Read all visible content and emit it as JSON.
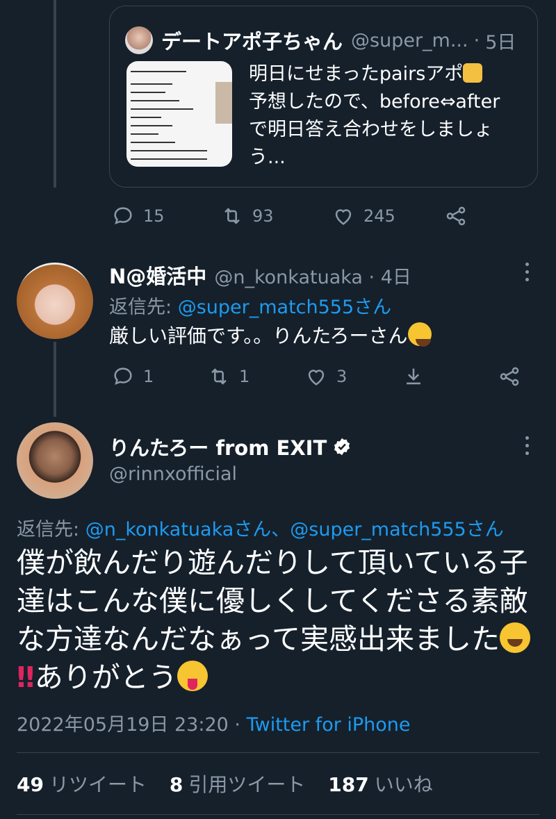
{
  "quoted_tweet": {
    "name": "デートアポ子ちゃん",
    "handle": "@super_m...",
    "sep": "·",
    "time": "5日",
    "text_lines": [
      "明日にせまったpairsアポ",
      "予想したので、before⇔after",
      "で明日答え合わせをしましょ",
      "う..."
    ]
  },
  "quoted_actions": {
    "replies": "15",
    "retweets": "93",
    "likes": "245"
  },
  "reply_tweet": {
    "name": "N@婚活中",
    "handle": "@n_konkatuaka · 4日",
    "replying_prefix": "返信先:",
    "replying_to": "@super_match555さん",
    "text": "厳しい評価です。。りんたろーさん"
  },
  "reply_actions": {
    "replies": "1",
    "retweets": "1",
    "likes": "3"
  },
  "main_tweet": {
    "name": "りんたろー from EXIT",
    "handle": "@rinnxofficial",
    "replying_prefix": "返信先:",
    "replying_to": "@n_konkatuakaさん、@super_match555さん",
    "text": "僕が飲んだり遊んだりして頂いている子達はこんな僕に優しくしてくださる素敵な方達なんだなぁって実感出来ました",
    "text_tail": "ありがとう",
    "timestamp": "2022年05月19日 23:20",
    "source_sep": "·",
    "source": "Twitter for iPhone"
  },
  "stats": {
    "retweets_count": "49",
    "retweets_label": "リツイート",
    "quotes_count": "8",
    "quotes_label": "引用ツイート",
    "likes_count": "187",
    "likes_label": "いいね"
  },
  "colors": {
    "background": "#15202b",
    "text": "#ffffff",
    "muted": "#8b98a5",
    "link": "#1d9bf0",
    "border": "#38444d"
  }
}
